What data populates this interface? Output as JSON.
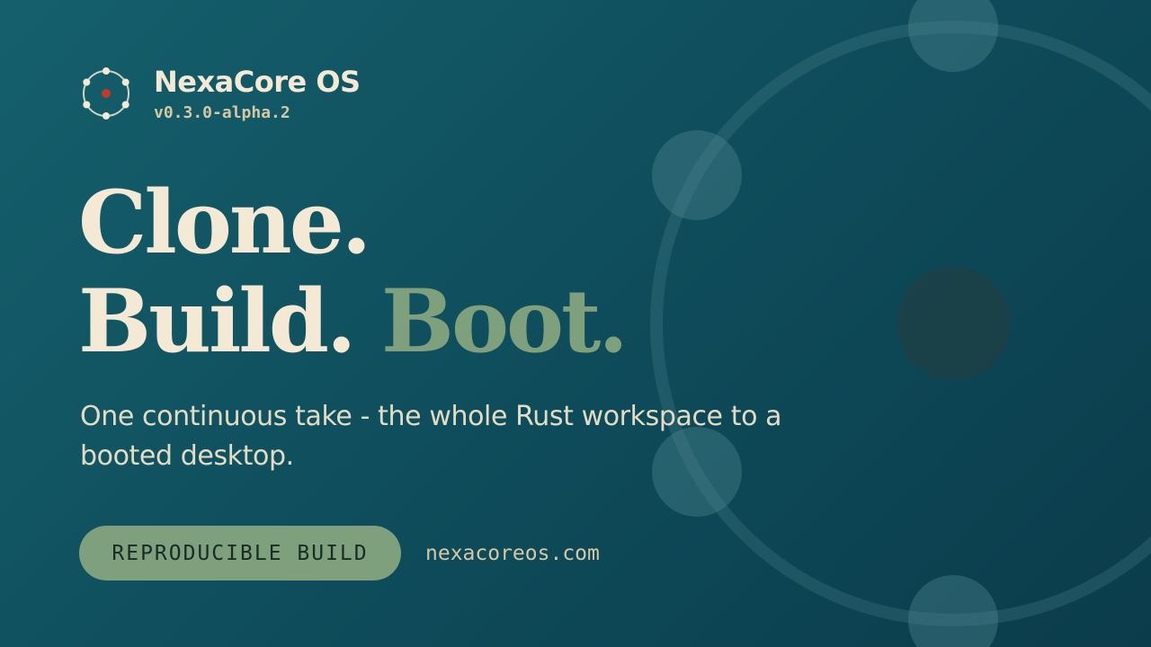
{
  "brand": {
    "name": "NexaCore OS",
    "version": "v0.3.0-alpha.2",
    "logo_icon": "orbit-nodes-logo"
  },
  "headline": {
    "line1": "Clone.",
    "line2_a": "Build.",
    "line2_b": "Boot."
  },
  "subtitle": "One continuous take - the whole Rust workspace to a booted desktop.",
  "badge": {
    "label": "REPRODUCIBLE BUILD"
  },
  "site": {
    "url": "nexacoreos.com"
  },
  "colors": {
    "background": "#0e4b5a",
    "cream": "#f3e9d4",
    "sage": "#7ea07c",
    "logo_core": "#c0392b"
  }
}
